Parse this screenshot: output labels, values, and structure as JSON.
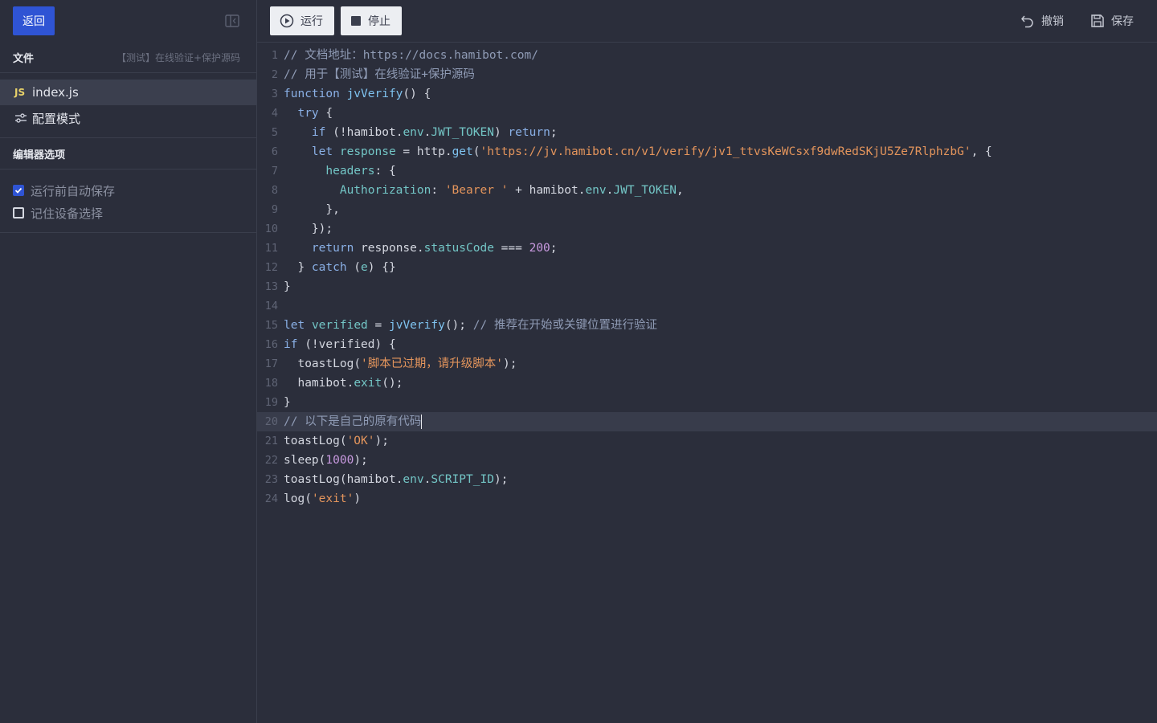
{
  "sidebar": {
    "back_label": "返回",
    "files_header": "文件",
    "project_name": "【测试】在线验证+保护源码",
    "files": [
      {
        "badge": "JS",
        "name": "index.js"
      },
      {
        "name": "配置模式"
      }
    ],
    "editor_options_header": "编辑器选项",
    "options": [
      {
        "label": "运行前自动保存",
        "checked": true
      },
      {
        "label": "记住设备选择",
        "checked": false
      }
    ]
  },
  "toolbar": {
    "run_label": "运行",
    "stop_label": "停止",
    "undo_label": "撤销",
    "save_label": "保存"
  },
  "editor": {
    "current_line": 20,
    "lines": [
      "// 文档地址：https://docs.hamibot.com/",
      "// 用于【测试】在线验证+保护源码",
      "function jvVerify() {",
      "  try {",
      "    if (!hamibot.env.JWT_TOKEN) return;",
      "    let response = http.get('https://jv.hamibot.cn/v1/verify/jv1_ttvsKeWCsxf9dwRedSKjU5Ze7RlphzbG', {",
      "      headers: {",
      "        Authorization: 'Bearer ' + hamibot.env.JWT_TOKEN,",
      "      },",
      "    });",
      "    return response.statusCode === 200;",
      "  } catch (e) {}",
      "}",
      "",
      "let verified = jvVerify(); // 推荐在开始或关键位置进行验证",
      "if (!verified) {",
      "  toastLog('脚本已过期，请升级脚本');",
      "  hamibot.exit();",
      "}",
      "// 以下是自己的原有代码",
      "toastLog('OK');",
      "sleep(1000);",
      "toastLog(hamibot.env.SCRIPT_ID);",
      "log('exit')"
    ]
  },
  "colors": {
    "accent": "#2f54d4",
    "background": "#2b2e3b",
    "comment": "#8f9bb5",
    "keyword": "#8ab0e6",
    "string": "#e4955c",
    "number": "#c99ae0",
    "property": "#73c6c6"
  },
  "icons": [
    "sidebar-collapse-icon",
    "play-circle-icon",
    "stop-square-icon",
    "undo-icon",
    "save-icon",
    "sliders-icon",
    "checkbox-checked-icon"
  ]
}
